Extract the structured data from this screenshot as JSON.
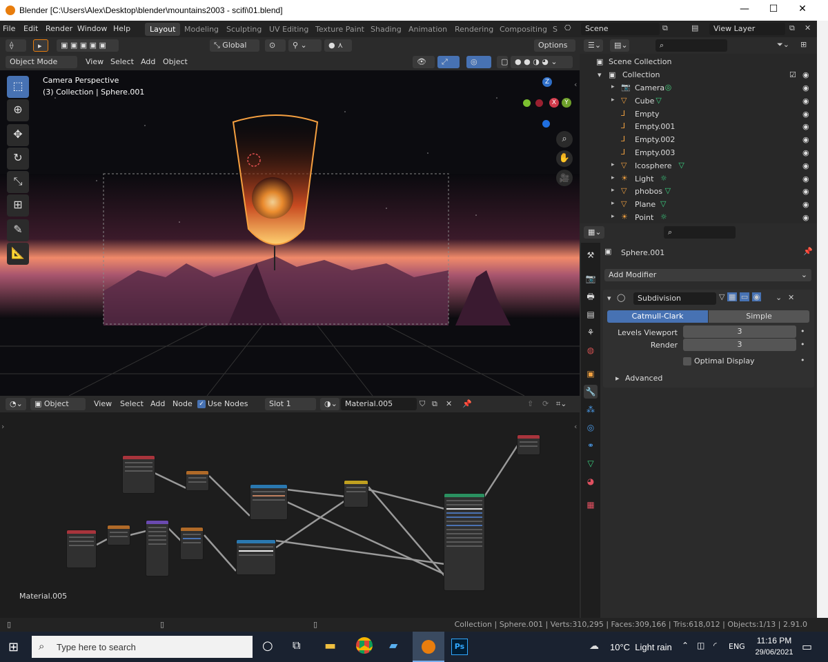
{
  "window": {
    "title": "Blender [C:\\Users\\Alex\\Desktop\\blender\\mountains2003 - scifi\\01.blend]",
    "minimize": "—",
    "maximize": "☐",
    "close": "✕"
  },
  "menus": [
    "File",
    "Edit",
    "Render",
    "Window",
    "Help"
  ],
  "workspaces": [
    "Layout",
    "Modeling",
    "Sculpting",
    "UV Editing",
    "Texture Paint",
    "Shading",
    "Animation",
    "Rendering",
    "Compositing",
    "S"
  ],
  "active_workspace": "Layout",
  "scene": {
    "label": "Scene",
    "view_layer": "View Layer"
  },
  "viewport_tools": {
    "orientation": "Global",
    "options": "Options"
  },
  "viewport_header": {
    "mode": "Object Mode",
    "view": "View",
    "select": "Select",
    "add": "Add",
    "object": "Object"
  },
  "viewport": {
    "camera_label": "Camera Perspective",
    "collection_label": "(3) Collection | Sphere.001",
    "gizmo": {
      "z": "Z",
      "x": "X",
      "y": "Y"
    }
  },
  "toolbar_icons": [
    "select-box-icon",
    "cursor-icon",
    "move-icon",
    "rotate-icon",
    "scale-icon",
    "transform-icon",
    "annotate-icon",
    "measure-icon"
  ],
  "node_header": {
    "editor": "Object",
    "view": "View",
    "select": "Select",
    "add": "Add",
    "node": "Node",
    "use_nodes": "Use Nodes",
    "slot": "Slot 1",
    "material": "Material.005"
  },
  "node_editor": {
    "material_label": "Material.005"
  },
  "outliner": {
    "scene_collection": "Scene Collection",
    "collection": "Collection",
    "items": [
      {
        "name": "Camera",
        "type": "camera",
        "expandable": true
      },
      {
        "name": "Cube",
        "type": "mesh",
        "expandable": true
      },
      {
        "name": "Empty",
        "type": "empty",
        "expandable": false
      },
      {
        "name": "Empty.001",
        "type": "empty",
        "expandable": false
      },
      {
        "name": "Empty.002",
        "type": "empty",
        "expandable": false
      },
      {
        "name": "Empty.003",
        "type": "empty",
        "expandable": false
      },
      {
        "name": "Icosphere",
        "type": "mesh",
        "expandable": true
      },
      {
        "name": "Light",
        "type": "light",
        "expandable": true
      },
      {
        "name": "phobos",
        "type": "mesh",
        "expandable": true
      },
      {
        "name": "Plane",
        "type": "mesh",
        "expandable": true
      },
      {
        "name": "Point",
        "type": "light",
        "expandable": true
      }
    ]
  },
  "properties": {
    "object_name": "Sphere.001",
    "add_modifier": "Add Modifier",
    "modifier_name": "Subdivision",
    "mode_a": "Catmull-Clark",
    "mode_b": "Simple",
    "levels_viewport_label": "Levels Viewport",
    "levels_viewport_value": "3",
    "render_label": "Render",
    "render_value": "3",
    "optimal_display": "Optimal Display",
    "advanced": "Advanced"
  },
  "status": {
    "text": "Collection | Sphere.001 | Verts:310,295 | Faces:309,166 | Tris:618,012 | Objects:1/13 | 2.91.0"
  },
  "taskbar": {
    "search_placeholder": "Type here to search",
    "weather": "10°C  Light rain",
    "lang": "ENG",
    "time": "11:16 PM",
    "date": "29/06/2021",
    "ps_label": "Ps"
  },
  "colors": {
    "accent": "#4772b3",
    "blender_orange": "#e87d0d",
    "taskbar": "#1a2230"
  }
}
